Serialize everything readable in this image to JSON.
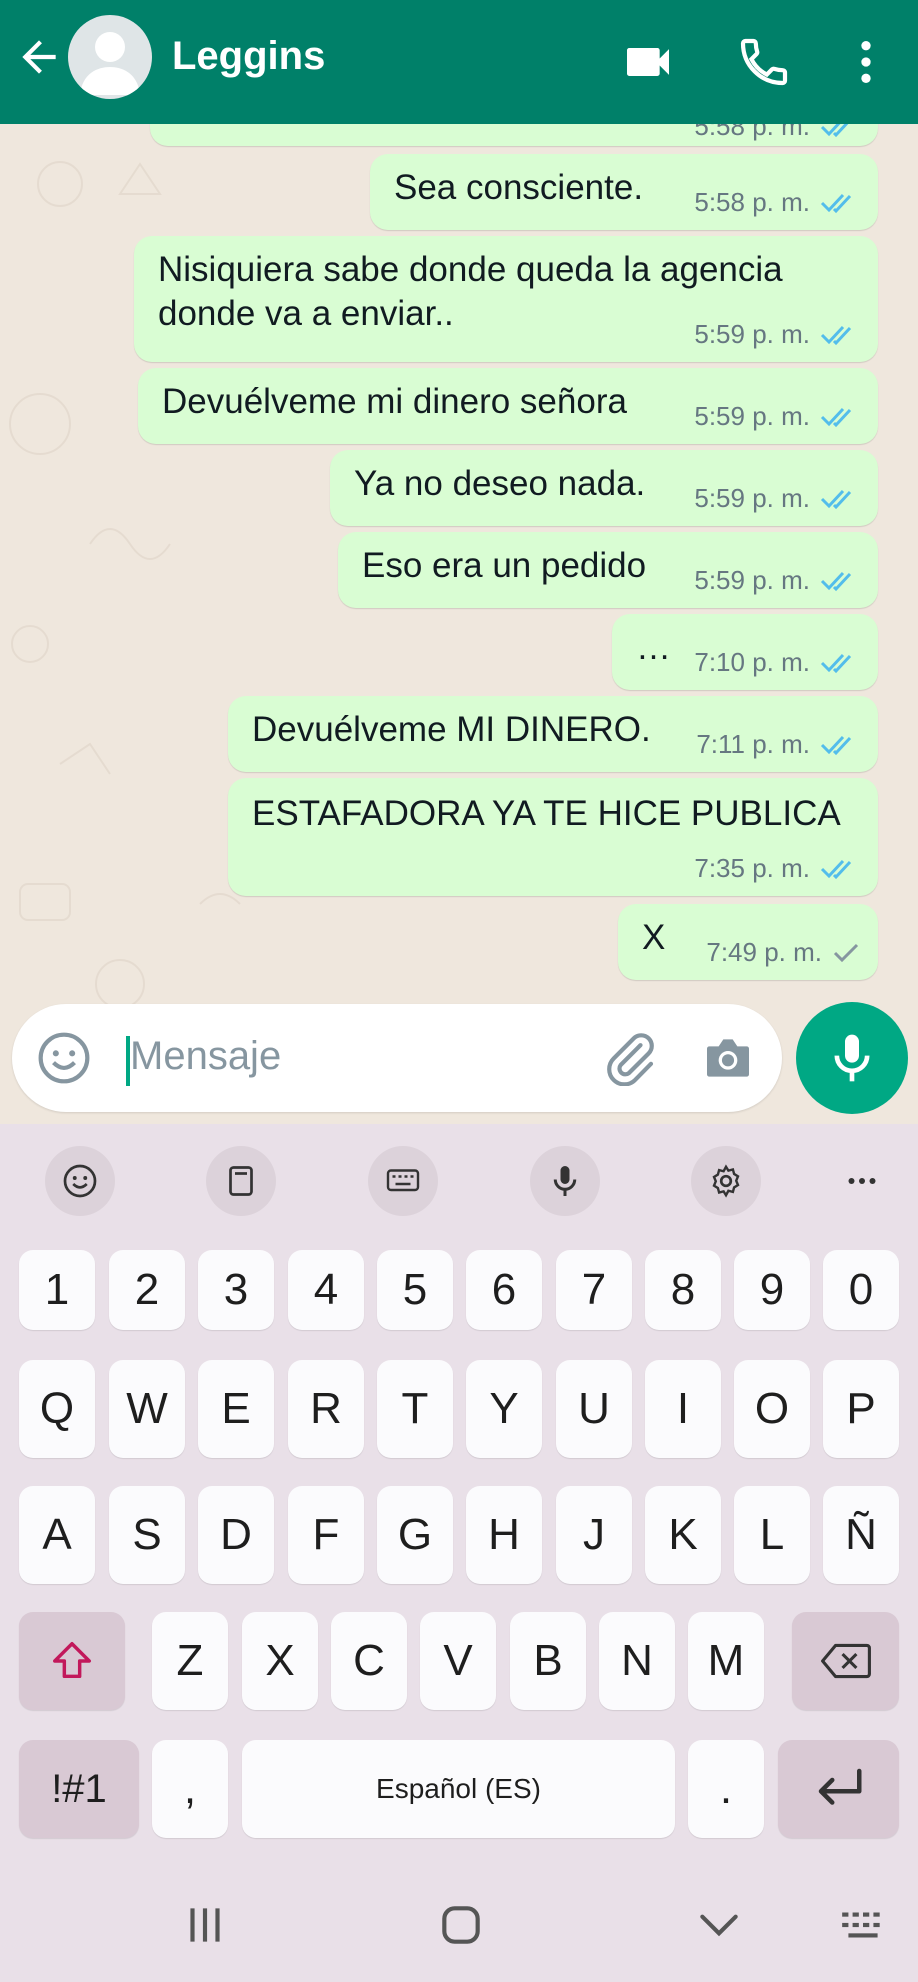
{
  "header": {
    "contact_name": "Leggins",
    "back_icon": "arrow-back-icon",
    "avatar_icon": "default-avatar-icon",
    "video_icon": "video-call-icon",
    "call_icon": "phone-icon",
    "menu_icon": "more-vertical-icon",
    "color": "#008069"
  },
  "messages": [
    {
      "text": "Sea consciente.",
      "time": "5:58 p. m.",
      "status": "read"
    },
    {
      "text": "Nisiquiera sabe donde queda la agencia donde va a enviar..",
      "time": "5:59 p. m.",
      "status": "read"
    },
    {
      "text": "Devuélveme mi dinero señora",
      "time": "5:59 p. m.",
      "status": "read"
    },
    {
      "text": "Ya no deseo nada.",
      "time": "5:59 p. m.",
      "status": "read"
    },
    {
      "text": "Eso era un pedido",
      "time": "5:59 p. m.",
      "status": "read"
    },
    {
      "text": "…",
      "time": "7:10 p. m.",
      "status": "read"
    },
    {
      "text": "Devuélveme MI DINERO.",
      "time": "7:11 p. m.",
      "status": "read"
    },
    {
      "text": "ESTAFADORA YA TE HICE PUBLICA",
      "time": "7:35 p. m.",
      "status": "read"
    },
    {
      "text": "X",
      "time": "7:49 p. m.",
      "status": "sent"
    }
  ],
  "partial_top_message": {
    "time": "5:58 p. m."
  },
  "composer": {
    "placeholder": "Mensaje",
    "emoji_icon": "emoji-icon",
    "attach_icon": "paperclip-icon",
    "camera_icon": "camera-icon",
    "mic_icon": "mic-icon"
  },
  "keyboard": {
    "toolbar": [
      "emoji-icon",
      "clipboard-icon",
      "keyboard-layout-icon",
      "voice-input-icon",
      "settings-icon",
      "more-horizontal-icon"
    ],
    "row_numbers": [
      "1",
      "2",
      "3",
      "4",
      "5",
      "6",
      "7",
      "8",
      "9",
      "0"
    ],
    "row_1": [
      "Q",
      "W",
      "E",
      "R",
      "T",
      "Y",
      "U",
      "I",
      "O",
      "P"
    ],
    "row_2": [
      "A",
      "S",
      "D",
      "F",
      "G",
      "H",
      "J",
      "K",
      "L",
      "Ñ"
    ],
    "row_3": [
      "Z",
      "X",
      "C",
      "V",
      "B",
      "N",
      "M"
    ],
    "symbols_label": "!#1",
    "comma_label": ",",
    "space_label": "Español (ES)",
    "period_label": ".",
    "shift_icon": "shift-icon",
    "backspace_icon": "backspace-icon",
    "enter_icon": "enter-icon"
  },
  "navbar": [
    "recent-apps-icon",
    "home-icon",
    "back-chevron-icon",
    "keyboard-switch-icon"
  ]
}
